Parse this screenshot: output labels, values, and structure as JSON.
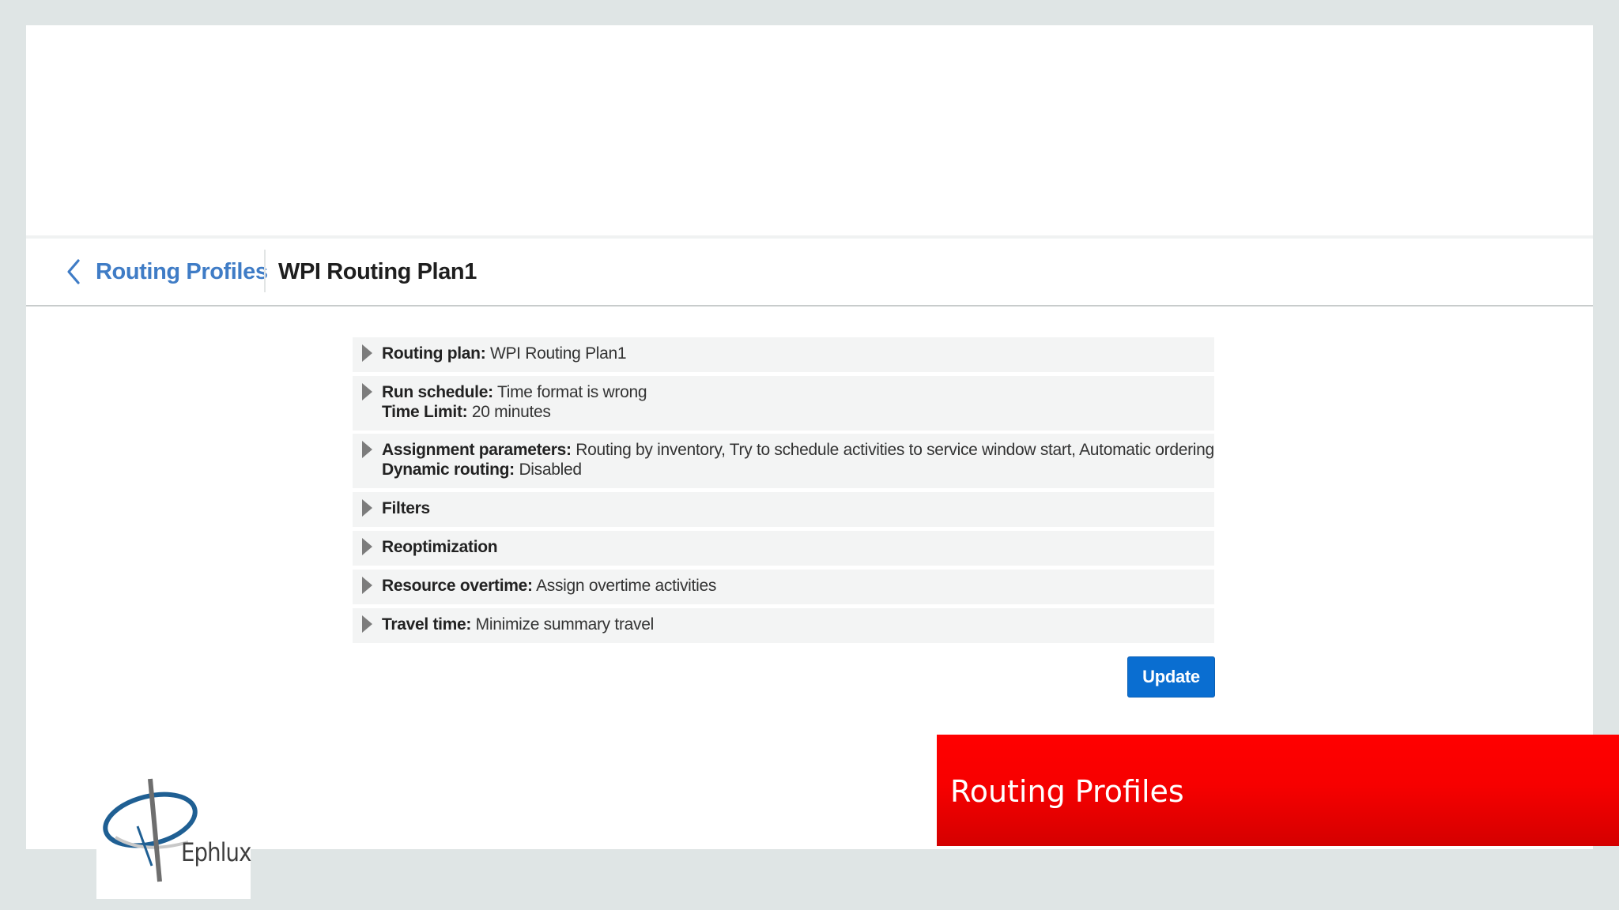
{
  "breadcrumb": {
    "parent_label": "Routing Profiles",
    "current_title": "WPI Routing Plan1"
  },
  "sections": [
    {
      "label": "Routing plan:",
      "value": "WPI Routing Plan1"
    },
    {
      "label": "Run schedule:",
      "value": "Time format is wrong",
      "label2": "Time Limit:",
      "value2": "20 minutes"
    },
    {
      "label": "Assignment parameters:",
      "value": "Routing by inventory, Try to schedule activities to service window start, Automatic ordering",
      "label2": "Dynamic routing:",
      "value2": "Disabled"
    },
    {
      "label": "Filters"
    },
    {
      "label": "Reoptimization"
    },
    {
      "label": "Resource overtime:",
      "value": "Assign overtime activities"
    },
    {
      "label": "Travel time:",
      "value": "Minimize summary travel"
    }
  ],
  "actions": {
    "update_label": "Update"
  },
  "banner": {
    "text": "Routing Profiles"
  },
  "logo": {
    "text": "Ephlux"
  },
  "colors": {
    "link": "#3f7cc6",
    "primary_button": "#0a6ed1",
    "banner": "#ff0000"
  }
}
